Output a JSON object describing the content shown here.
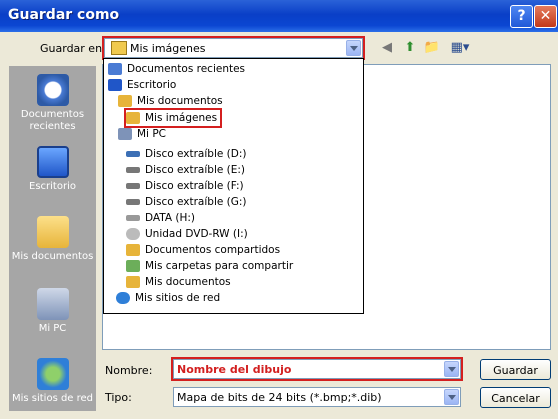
{
  "window": {
    "title": "Guardar como",
    "help": "?",
    "close": "✕"
  },
  "save_in": {
    "label": "Guardar en:",
    "value": "Mis imágenes"
  },
  "toolbar": {
    "back": "◀",
    "up": "⬆",
    "newfolder": "📁",
    "views": "▦▾"
  },
  "places": [
    {
      "label": "Documentos recientes",
      "icon": "clock-icon"
    },
    {
      "label": "Escritorio",
      "icon": "desktop-icon"
    },
    {
      "label": "Mis documentos",
      "icon": "folder-icon"
    },
    {
      "label": "Mi PC",
      "icon": "computer-icon"
    },
    {
      "label": "Mis sitios de red",
      "icon": "network-icon"
    }
  ],
  "dropdown_items": [
    {
      "label": "Documentos recientes",
      "icon": "clock-icon"
    },
    {
      "label": "Escritorio",
      "icon": "desktop-icon"
    },
    {
      "label": "Mis documentos",
      "icon": "folder-icon"
    },
    {
      "label": "Mis imágenes",
      "icon": "folder-icon"
    },
    {
      "label": "Mi PC",
      "icon": "computer-icon"
    },
    {
      "label": "Disco extraíble (D:)",
      "icon": "drive-icon"
    },
    {
      "label": "Disco extraíble (E:)",
      "icon": "drive-icon"
    },
    {
      "label": "Disco extraíble (F:)",
      "icon": "drive-icon"
    },
    {
      "label": "Disco extraíble (G:)",
      "icon": "drive-icon"
    },
    {
      "label": "DATA (H:)",
      "icon": "drive-icon"
    },
    {
      "label": "Unidad DVD-RW (I:)",
      "icon": "dvd-icon"
    },
    {
      "label": "Documentos compartidos",
      "icon": "folder-icon"
    },
    {
      "label": "Mis carpetas para compartir",
      "icon": "folder-icon"
    },
    {
      "label": "Mis documentos",
      "icon": "folder-icon"
    },
    {
      "label": "Mis sitios de red",
      "icon": "network-icon"
    }
  ],
  "filename": {
    "label": "Nombre:",
    "value": "Nombre del dibujo"
  },
  "filetype": {
    "label": "Tipo:",
    "value": "Mapa de bits de 24 bits (*.bmp;*.dib)"
  },
  "buttons": {
    "save": "Guardar",
    "cancel": "Cancelar"
  }
}
